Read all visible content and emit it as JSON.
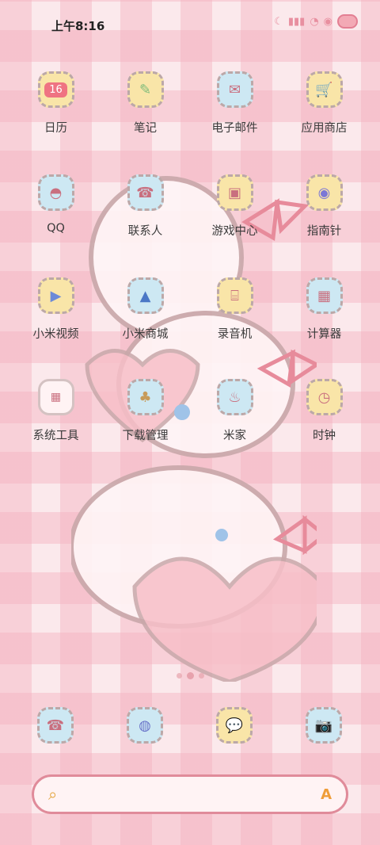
{
  "status": {
    "time": "上午8:16",
    "icons": [
      "moon-icon",
      "signal-icon",
      "wifi-icon",
      "frog-icon",
      "battery-icon"
    ]
  },
  "apps": [
    {
      "label": "日历",
      "icon": "calendar-icon",
      "badge": "16",
      "color": "#f9e5a8"
    },
    {
      "label": "笔记",
      "icon": "note-icon",
      "color": "#f9e5a8"
    },
    {
      "label": "电子邮件",
      "icon": "mail-icon",
      "color": "#cde8f3"
    },
    {
      "label": "应用商店",
      "icon": "shop-icon",
      "color": "#f9e5a8"
    },
    {
      "label": "QQ",
      "icon": "penguin-icon",
      "color": "#cde8f3"
    },
    {
      "label": "联系人",
      "icon": "phonebook-icon",
      "color": "#cde8f3"
    },
    {
      "label": "游戏中心",
      "icon": "game-icon",
      "color": "#f9e5a8"
    },
    {
      "label": "指南针",
      "icon": "compass-icon",
      "color": "#f9e5a8"
    },
    {
      "label": "小米视频",
      "icon": "video-icon",
      "color": "#f9e5a8"
    },
    {
      "label": "小米商城",
      "icon": "shopping-bag-icon",
      "color": "#cde8f3"
    },
    {
      "label": "录音机",
      "icon": "recorder-icon",
      "color": "#f9e5a8"
    },
    {
      "label": "计算器",
      "icon": "calculator-icon",
      "color": "#cde8f3"
    },
    {
      "label": "系统工具",
      "icon": "folder-icon",
      "color": "#fff3f4"
    },
    {
      "label": "下载管理",
      "icon": "download-icon",
      "color": "#cde8f3"
    },
    {
      "label": "米家",
      "icon": "cupcake-icon",
      "color": "#cde8f3"
    },
    {
      "label": "时钟",
      "icon": "clock-icon",
      "color": "#f9e5a8"
    }
  ],
  "pager": {
    "dots": 3,
    "active": 1
  },
  "dock": [
    {
      "icon": "phone-icon",
      "color": "#cde8f3"
    },
    {
      "icon": "browser-icon",
      "color": "#cde8f3"
    },
    {
      "icon": "message-icon",
      "color": "#f9e5a8"
    },
    {
      "icon": "camera-icon",
      "color": "#cde8f3"
    }
  ],
  "search": {
    "icon": "search-icon",
    "assistant_icon": "assistant-icon",
    "assistant_glyph": "A"
  }
}
